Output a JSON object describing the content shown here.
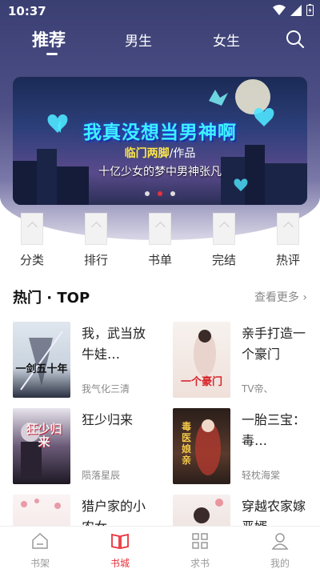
{
  "status": {
    "time": "10:37"
  },
  "tabs": [
    {
      "label": "推荐"
    },
    {
      "label": "男生"
    },
    {
      "label": "女生"
    }
  ],
  "banner": {
    "title": "我真没想当男神啊",
    "author_name": "临门两脚",
    "author_suffix": "/作品",
    "subtitle": "十亿少女的梦中男神张凡",
    "active_dot": 1
  },
  "categories": [
    {
      "label": "分类"
    },
    {
      "label": "排行"
    },
    {
      "label": "书单"
    },
    {
      "label": "完结"
    },
    {
      "label": "热评"
    }
  ],
  "hot": {
    "title": "热门 · TOP",
    "more": "查看更多",
    "books": [
      {
        "title": "我，武当放牛娃…",
        "author": "我气化三清",
        "cover_text": "一剑五十年",
        "cover_color": "#e9eef3"
      },
      {
        "title": "亲手打造一个豪门",
        "author": "TV帝、",
        "cover_text": "一个豪门",
        "cover_color": "#f6e9e6"
      },
      {
        "title": "狂少归来",
        "author": "陨落星辰",
        "cover_text": "狂少归来",
        "cover_color": "#2a2433"
      },
      {
        "title": "一胎三宝：毒…",
        "author": "轻枕海棠",
        "cover_text": "毒医娘亲",
        "cover_color": "#3a2a26"
      },
      {
        "title": "猎户家的小农女",
        "author": "",
        "cover_text": "",
        "cover_color": "#f7eeee"
      },
      {
        "title": "穿越农家嫁恶婿",
        "author": "",
        "cover_text": "",
        "cover_color": "#f3ece9"
      }
    ]
  },
  "bottom_nav": [
    {
      "label": "书架"
    },
    {
      "label": "书城"
    },
    {
      "label": "求书"
    },
    {
      "label": "我的"
    }
  ],
  "colors": {
    "accent": "#e8323c",
    "header": "#3a3f72"
  }
}
